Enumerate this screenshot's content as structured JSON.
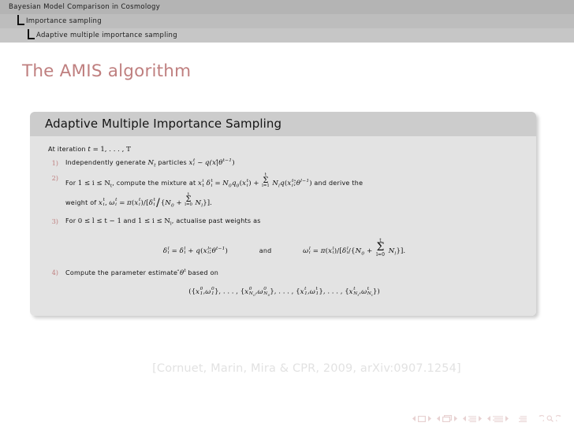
{
  "headline": {
    "bars": [
      {
        "label": "Bayesian Model Comparison in Cosmology",
        "level": 0
      },
      {
        "label": "Importance sampling",
        "level": 1
      },
      {
        "label": "Adaptive multiple importance sampling",
        "level": 2
      }
    ]
  },
  "frame": {
    "title": "The AMIS algorithm"
  },
  "block": {
    "title": "Adaptive Multiple Importance Sampling",
    "intro": {
      "text_a": "At iteration",
      "math_t": "t",
      "eq": "=",
      "values": "1, . . . , T"
    },
    "items": [
      {
        "number": "1)",
        "text_a": "Independently generate",
        "math_nt": "N",
        "math_nt_sub": "t",
        "text_b": "particles",
        "math_x": "x",
        "math_x_sub": "i",
        "math_x_sup": "t",
        "rel": "~",
        "dist": "q(x|",
        "theta": "θ",
        "theta_sup": "t−1",
        "close": ")"
      },
      {
        "number": "2)",
        "text_a": "For",
        "range": "1 ≤ i ≤ N",
        "range_sub": "t",
        "text_b": ", compute the mixture at",
        "text_c": "and derive the",
        "cont_text": "weight of",
        "cont_end": "."
      },
      {
        "number": "3)",
        "text_a": "For",
        "range_a": "0 ≤ l ≤ t − 1",
        "text_b": "and",
        "range_b": "1 ≤ i ≤ N",
        "range_b_sub": "l",
        "text_c": ", actualise past weights as",
        "conj": "and"
      },
      {
        "number": "4)",
        "text_a": "Compute the parameter estimate",
        "theta": "θ",
        "theta_sup": "t",
        "text_b": "based on"
      }
    ]
  },
  "citation": "[Cornuet, Marin, Mira & CPR, 2009, arXiv:0907.1254]",
  "navigation": {
    "symbols": [
      "prev-slide-arrow",
      "slide-icon",
      "next-slide-arrow",
      "prev-frame-arrow",
      "frame-icon",
      "next-frame-arrow",
      "prev-subsection-arrow",
      "subsection-icon",
      "next-subsection-arrow",
      "prev-section-arrow",
      "section-icon",
      "next-section-arrow",
      "doc-icon",
      "back-icon",
      "search-icon",
      "forward-icon"
    ]
  },
  "colors": {
    "accent": "#bf7f7f",
    "block_title_bg": "#cccccc",
    "block_body_bg": "#e3e3e3",
    "headline_bar_1": "#b4b4b4",
    "headline_bar_2": "#bdbdbd",
    "headline_bar_3": "#c6c6c6",
    "citation_text": "#e2e2e2"
  }
}
